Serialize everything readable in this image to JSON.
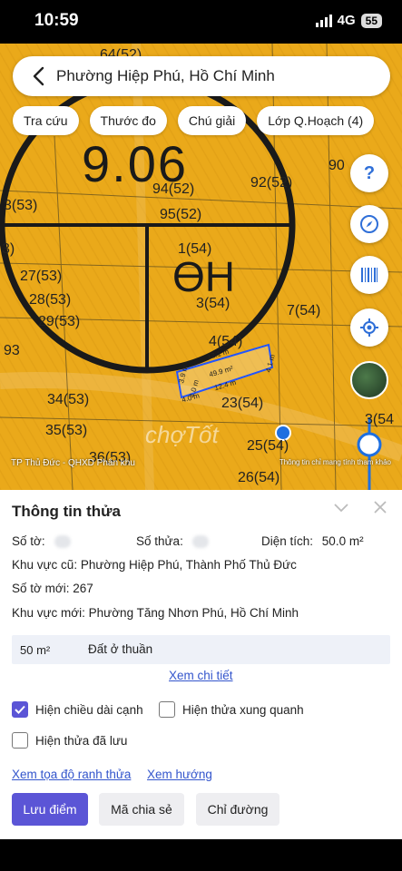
{
  "status_bar": {
    "time": "10:59",
    "network": "4G",
    "battery": "55"
  },
  "search": {
    "location": "Phường Hiệp Phú, Hồ Chí Minh"
  },
  "chips": [
    {
      "label": "Tra cứu"
    },
    {
      "label": "Thước đo"
    },
    {
      "label": "Chú giải"
    },
    {
      "label": "Lớp Q.Hoạch (4)"
    }
  ],
  "map": {
    "big_label": "9.06",
    "zone_label": "ӨН",
    "parcel_labels": [
      "64(52)",
      "3(53)",
      "94(52)",
      "95(52)",
      "92(52)",
      "27(53)",
      "28(53)",
      "29(53)",
      "1(54)",
      "3(54)",
      "7(54)",
      "34(53)",
      "35(53)",
      "36(53)",
      "4(54)",
      "23(54)",
      "25(54)",
      "26(54)",
      "3)",
      "90",
      "93",
      "3(54"
    ],
    "dims": [
      "12.1 m",
      "4.1 m",
      "49.9 m²",
      "12.4 m",
      "3.9 m",
      "4.0 m",
      "4.0 m"
    ],
    "footer_left": "TP Thủ Đức - QHXD Phân khu",
    "footer_right": "Thông tin chỉ mang tính tham khảo",
    "watermark": "chợTốt"
  },
  "panel": {
    "title": "Thông tin thửa",
    "so_to_label": "Số tờ:",
    "so_thua_label": "Số thửa:",
    "dien_tich_label": "Diện tích:",
    "dien_tich_value": "50.0 m²",
    "khu_vuc_cu": "Khu vực cũ: Phường Hiệp Phú, Thành Phố Thủ Đức",
    "so_to_moi": "Số tờ mới: 267",
    "khu_vuc_moi": "Khu vực mới: Phường Tăng Nhơn Phú, Hồ Chí Minh",
    "land_area": "50 m²",
    "land_type": "Đất ở thuần",
    "detail_link": "Xem chi tiết",
    "checkbox_edge": "Hiện chiều dài cạnh",
    "checkbox_edge_checked": true,
    "checkbox_neighbors": "Hiện thửa xung quanh",
    "checkbox_neighbors_checked": false,
    "checkbox_saved": "Hiện thửa đã lưu",
    "checkbox_saved_checked": false,
    "link_coords": "Xem tọa độ ranh thửa",
    "link_direction": "Xem hướng",
    "btn_save": "Lưu điểm",
    "btn_share": "Mã chia sẻ",
    "btn_route": "Chỉ đường"
  },
  "colors": {
    "accent": "#5b55d6",
    "link": "#3355cc",
    "map_bg": "#e8a818"
  }
}
